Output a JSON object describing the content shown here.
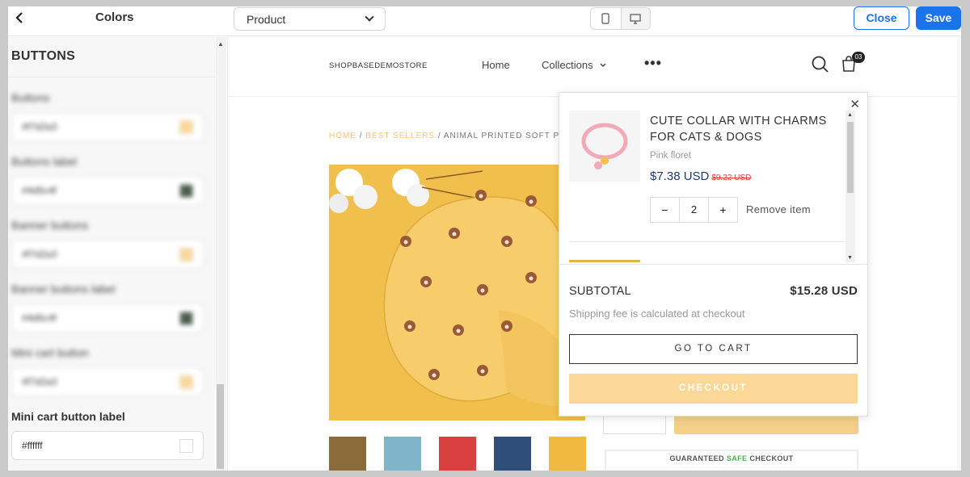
{
  "topbar": {
    "back_icon": "chevron-left-icon",
    "panel_title": "Colors",
    "page_select_value": "Product",
    "close_label": "Close",
    "save_label": "Save"
  },
  "sidebar": {
    "section_title": "BUTTONS",
    "fields": [
      {
        "label": "Buttons",
        "value": "#f7d2a3",
        "color": "#fbd898"
      },
      {
        "label": "Buttons label",
        "value": "#4d5c4f",
        "color": "#4d5c4f"
      },
      {
        "label": "Banner buttons",
        "value": "#f7d2a3",
        "color": "#fbd898"
      },
      {
        "label": "Banner buttons label",
        "value": "#4d5c4f",
        "color": "#4d5c4f"
      },
      {
        "label": "Mini cart button",
        "value": "#f7d2a3",
        "color": "#fbd898"
      }
    ],
    "mini_cart_label": {
      "label": "Mini cart button label",
      "value": "#ffffff",
      "color": "#ffffff"
    }
  },
  "store": {
    "logo": "SHOPBASEDEMOSTORE",
    "nav": {
      "home": "Home",
      "collections": "Collections",
      "more": "•••"
    },
    "cart_count": "03",
    "breadcrumb": {
      "home": "HOME",
      "sep1": " / ",
      "best": "BEST SELLERS",
      "sep2": " / ",
      "current": "ANIMAL PRINTED SOFT PU"
    },
    "guarantee": {
      "part1": "GUARANTEED ",
      "safe": "SAFE",
      "part2": " CHECKOUT"
    }
  },
  "minicart": {
    "item": {
      "title": "CUTE COLLAR WITH CHARMS FOR CATS & DOGS",
      "variant": "Pink floret",
      "price": "$7.38 USD",
      "old_price": "$9.22 USD",
      "qty": "2",
      "minus": "−",
      "plus": "+",
      "remove": "Remove item"
    },
    "subtotal_label": "SUBTOTAL",
    "subtotal_value": "$15.28 USD",
    "shipping_note": "Shipping fee is calculated at checkout",
    "go_to_cart": "GO TO CART",
    "checkout": "CHECKOUT"
  }
}
